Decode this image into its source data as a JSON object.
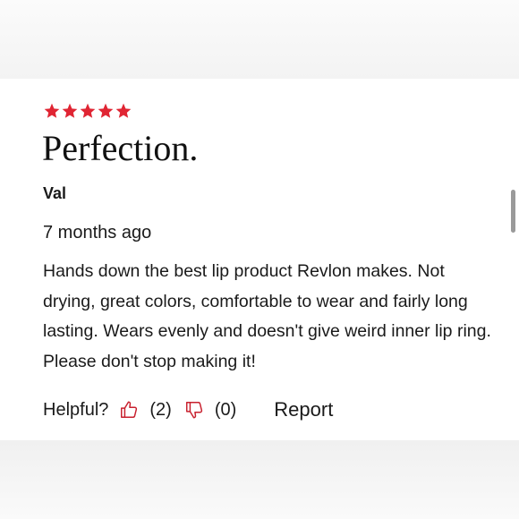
{
  "review": {
    "rating": 5,
    "rating_max": 5,
    "title": "Perfection.",
    "author": "Val",
    "date": "7 months ago",
    "body": "Hands down the best lip product Revlon makes. Not drying, great colors, comfortable to wear and fairly long lasting. Wears evenly and doesn't give weird inner lip ring. Please don't stop making it!"
  },
  "feedback": {
    "helpful_label": "Helpful?",
    "helpful_count": "(2)",
    "not_helpful_count": "(0)",
    "report_label": "Report"
  },
  "icons": {
    "star": "star-icon",
    "thumbs_up": "thumbs-up-icon",
    "thumbs_down": "thumbs-down-icon"
  },
  "colors": {
    "star": "#e02533",
    "thumb_icon": "#c8202e",
    "text": "#1a1a1a"
  }
}
